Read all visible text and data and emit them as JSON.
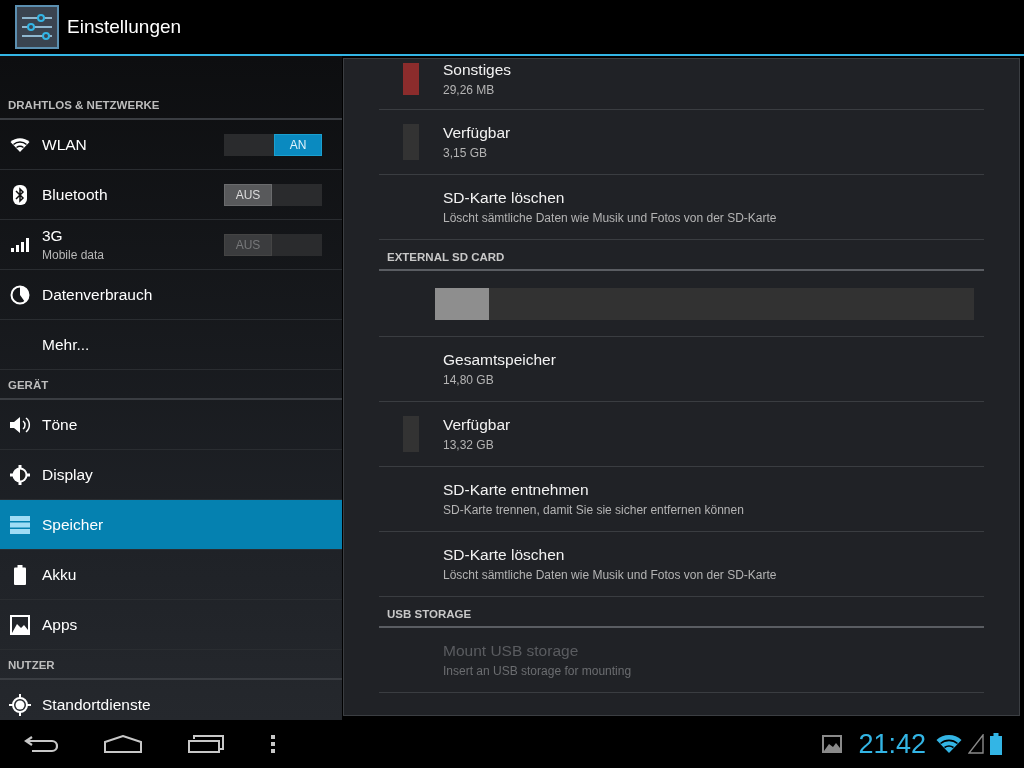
{
  "action_bar": {
    "title": "Einstellungen"
  },
  "sidebar": {
    "sections": [
      {
        "header": "DRAHTLOS & NETZWERKE",
        "items": [
          {
            "label": "WLAN",
            "kind": "toggle",
            "toggle": {
              "label": "AN",
              "on": true,
              "disabled": false
            },
            "selected": false
          },
          {
            "label": "Bluetooth",
            "kind": "toggle",
            "toggle": {
              "label": "AUS",
              "on": false,
              "disabled": false
            },
            "selected": false
          },
          {
            "label": "3G",
            "subtitle": "Mobile data",
            "kind": "toggle",
            "toggle": {
              "label": "AUS",
              "on": false,
              "disabled": true
            },
            "selected": false
          },
          {
            "label": "Datenverbrauch",
            "kind": "link",
            "selected": false
          },
          {
            "label": "Mehr...",
            "kind": "link",
            "selected": false
          }
        ]
      },
      {
        "header": "GERÄT",
        "items": [
          {
            "label": "Töne",
            "kind": "link",
            "selected": false
          },
          {
            "label": "Display",
            "kind": "link",
            "selected": false
          },
          {
            "label": "Speicher",
            "kind": "link",
            "selected": true
          },
          {
            "label": "Akku",
            "kind": "link",
            "selected": false
          },
          {
            "label": "Apps",
            "kind": "link",
            "selected": false
          }
        ]
      },
      {
        "header": "NUTZER",
        "items": [
          {
            "label": "Standortdienste",
            "kind": "link",
            "selected": false
          }
        ]
      }
    ]
  },
  "storage": {
    "rows": [
      {
        "kind": "legend",
        "title": "Sonstiges",
        "summary": "29,26 MB",
        "color": "#8b2c2c"
      },
      {
        "kind": "legend",
        "title": "Verfügbar",
        "summary": "3,15 GB",
        "color": "#333333"
      },
      {
        "kind": "action",
        "title": "SD-Karte löschen",
        "summary": "Löscht sämtliche Daten wie Musik und Fotos von der SD-Karte",
        "disabled": false
      },
      {
        "kind": "header",
        "title": "EXTERNAL SD CARD"
      },
      {
        "kind": "bar",
        "level": 0.1
      },
      {
        "kind": "action",
        "title": "Gesamtspeicher",
        "summary": "14,80 GB",
        "disabled": false
      },
      {
        "kind": "legend",
        "title": "Verfügbar",
        "summary": "13,32 GB",
        "color": "#333333"
      },
      {
        "kind": "action",
        "title": "SD-Karte entnehmen",
        "summary": "SD-Karte trennen, damit Sie sie sicher entfernen können",
        "disabled": false
      },
      {
        "kind": "action",
        "title": "SD-Karte löschen",
        "summary": "Löscht sämtliche Daten wie Musik und Fotos von der SD-Karte",
        "disabled": false
      },
      {
        "kind": "header",
        "title": "USB STORAGE"
      },
      {
        "kind": "action",
        "title": "Mount USB storage",
        "summary": "Insert an USB storage for mounting",
        "disabled": true
      }
    ]
  },
  "status_bar": {
    "time": "21:42"
  }
}
